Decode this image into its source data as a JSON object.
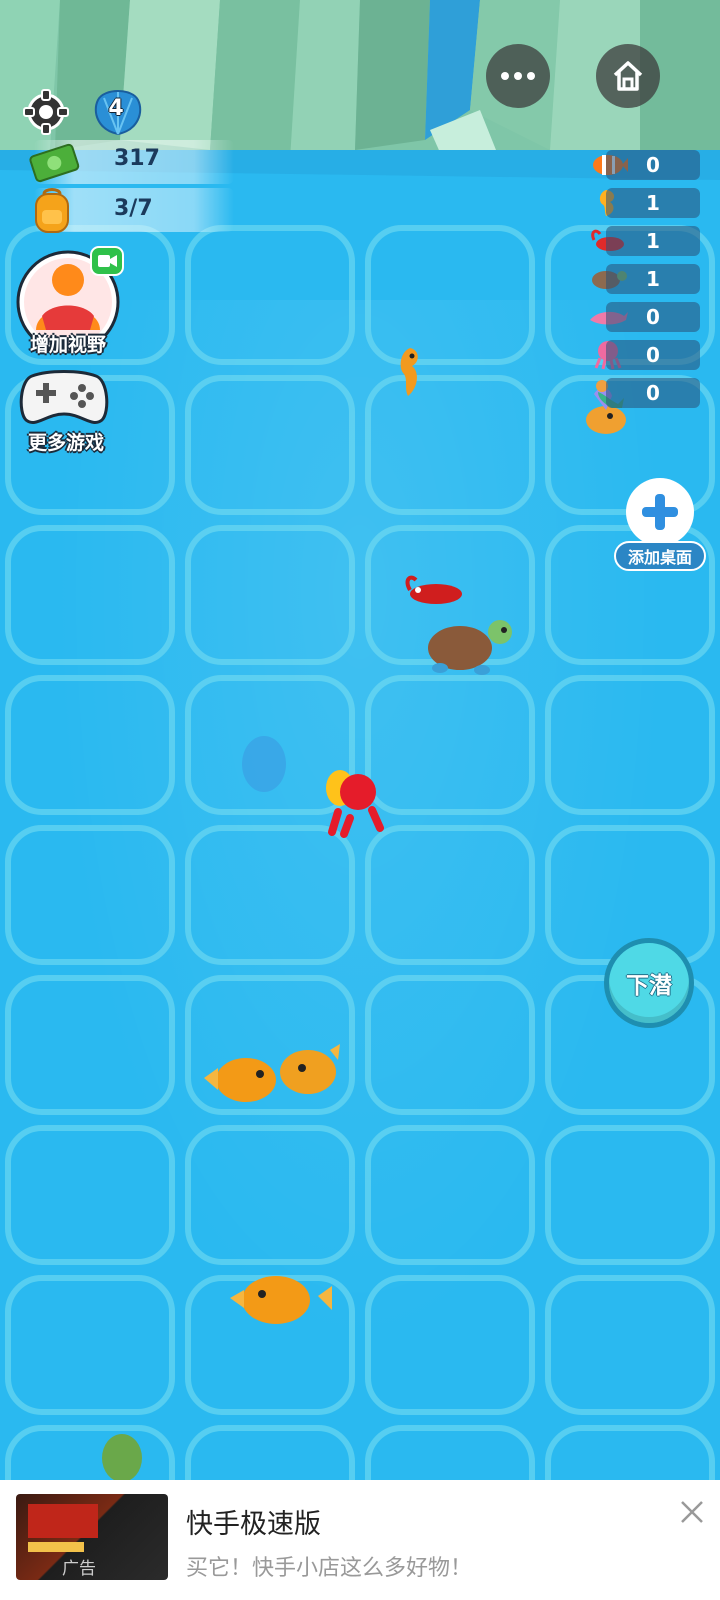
{
  "hud": {
    "level": "4",
    "money": "317",
    "capacity": "3/7",
    "increase_view_label": "增加视野",
    "more_games_label": "更多游戏",
    "add_desktop_label": "添加桌面",
    "dive_label": "下潜"
  },
  "collection": [
    {
      "icon": "clownfish-icon",
      "count": "0",
      "color": "#ff7a1a"
    },
    {
      "icon": "seahorse-icon",
      "count": "1",
      "color": "#ffb020"
    },
    {
      "icon": "lobster-icon",
      "count": "1",
      "color": "#e02a2a"
    },
    {
      "icon": "turtle-icon",
      "count": "1",
      "color": "#8c6a4f"
    },
    {
      "icon": "dolphin-icon",
      "count": "0",
      "color": "#f07aa8"
    },
    {
      "icon": "octopus-icon",
      "count": "0",
      "color": "#f06aa0"
    },
    {
      "icon": "mermaid-icon",
      "count": "0",
      "color": "#f0a040"
    }
  ],
  "ad": {
    "title": "快手极速版",
    "subtitle": "买它！快手小店这么多好物！",
    "badge": "广告"
  },
  "colors": {
    "water": "#2ab9f0",
    "dive_button": "#4fd9e6",
    "count_panel": "#28507a"
  }
}
